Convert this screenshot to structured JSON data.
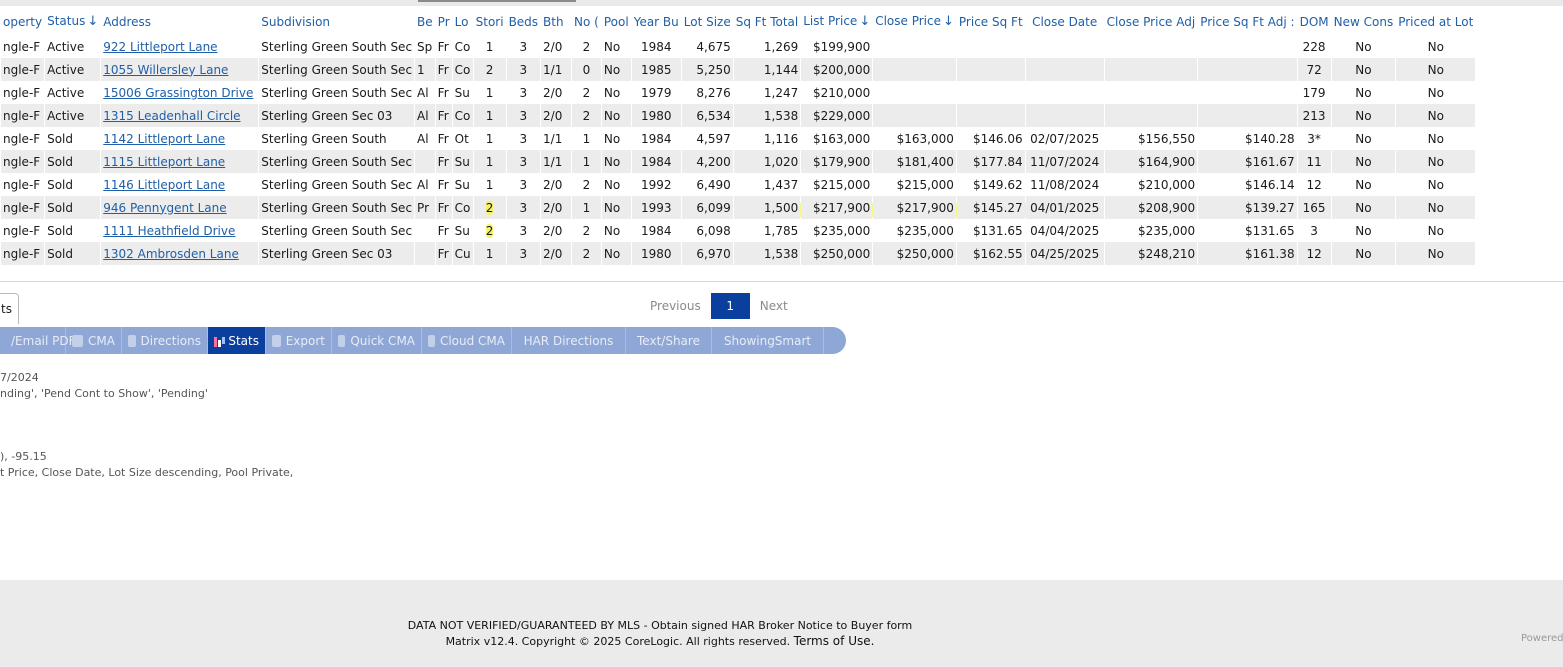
{
  "columns": [
    "operty",
    "Status",
    "Address",
    "Subdivision",
    "Be",
    "Pr",
    "Lo",
    "Stori",
    "Beds",
    "Bth",
    "No (",
    "Pool",
    "Year Bu",
    "Lot Size",
    "Sq Ft Total",
    "List Price",
    "Close Price",
    "Price Sq Ft",
    "Close Date",
    "Close Price Adj",
    "Price Sq Ft Adj :",
    "DOM",
    "New Cons",
    "Priced at Lot"
  ],
  "rows": [
    [
      "ngle-F",
      "Active",
      "922 Littleport Lane",
      "Sterling Green South Sec",
      "Sp",
      "Fr",
      "Co",
      "1",
      "3",
      "2/0",
      "2",
      "No",
      "1984",
      "4,675",
      "1,269",
      "$199,900",
      "",
      "",
      "",
      "",
      "",
      "228",
      "No",
      "No"
    ],
    [
      "ngle-F",
      "Active",
      "1055 Willersley Lane",
      "Sterling Green South Sec",
      "1",
      "Fr",
      "Co",
      "2",
      "3",
      "1/1",
      "0",
      "No",
      "1985",
      "5,250",
      "1,144",
      "$200,000",
      "",
      "",
      "",
      "",
      "",
      "72",
      "No",
      "No"
    ],
    [
      "ngle-F",
      "Active",
      "15006 Grassington Drive",
      "Sterling Green South Sec",
      "Al",
      "Fr",
      "Su",
      "1",
      "3",
      "2/0",
      "2",
      "No",
      "1979",
      "8,276",
      "1,247",
      "$210,000",
      "",
      "",
      "",
      "",
      "",
      "179",
      "No",
      "No"
    ],
    [
      "ngle-F",
      "Active",
      "1315 Leadenhall Circle",
      "Sterling Green Sec 03",
      "Al",
      "Fr",
      "Co",
      "1",
      "3",
      "2/0",
      "2",
      "No",
      "1980",
      "6,534",
      "1,538",
      "$229,000",
      "",
      "",
      "",
      "",
      "",
      "213",
      "No",
      "No"
    ],
    [
      "ngle-F",
      "Sold",
      "1142 Littleport Lane",
      "Sterling Green South",
      "Al",
      "Fr",
      "Ot",
      "1",
      "3",
      "1/1",
      "1",
      "No",
      "1984",
      "4,597",
      "1,116",
      "$163,000",
      "$163,000",
      "$146.06",
      "02/07/2025",
      "$156,550",
      "$140.28",
      "3*",
      "No",
      "No"
    ],
    [
      "ngle-F",
      "Sold",
      "1115 Littleport Lane",
      "Sterling Green South Sec",
      "",
      "Fr",
      "Su",
      "1",
      "3",
      "1/1",
      "1",
      "No",
      "1984",
      "4,200",
      "1,020",
      "$179,900",
      "$181,400",
      "$177.84",
      "11/07/2024",
      "$164,900",
      "$161.67",
      "11",
      "No",
      "No"
    ],
    [
      "ngle-F",
      "Sold",
      "1146 Littleport Lane",
      "Sterling Green South Sec",
      "Al",
      "Fr",
      "Su",
      "1",
      "3",
      "2/0",
      "2",
      "No",
      "1992",
      "6,490",
      "1,437",
      "$215,000",
      "$215,000",
      "$149.62",
      "11/08/2024",
      "$210,000",
      "$146.14",
      "12",
      "No",
      "No"
    ],
    [
      "ngle-F",
      "Sold",
      "946 Pennygent Lane",
      "Sterling Green South Sec",
      "Pr",
      "Fr",
      "Co",
      "2",
      "3",
      "2/0",
      "1",
      "No",
      "1993",
      "6,099",
      "1,500",
      "$217,900",
      "$217,900",
      "$145.27",
      "04/01/2025",
      "$208,900",
      "$139.27",
      "165",
      "No",
      "No"
    ],
    [
      "ngle-F",
      "Sold",
      "1111 Heathfield Drive",
      "Sterling Green South Sec",
      "",
      "Fr",
      "Su",
      "2",
      "3",
      "2/0",
      "2",
      "No",
      "1984",
      "6,098",
      "1,785",
      "$235,000",
      "$235,000",
      "$131.65",
      "04/04/2025",
      "$235,000",
      "$131.65",
      "3",
      "No",
      "No"
    ],
    [
      "ngle-F",
      "Sold",
      "1302 Ambrosden Lane",
      "Sterling Green Sec 03",
      "",
      "Fr",
      "Cu",
      "1",
      "3",
      "2/0",
      "2",
      "No",
      "1980",
      "6,970",
      "1,538",
      "$250,000",
      "$250,000",
      "$162.55",
      "04/25/2025",
      "$248,210",
      "$161.38",
      "12",
      "No",
      "No"
    ]
  ],
  "pager": {
    "previous": "Previous",
    "current": "1",
    "next": "Next"
  },
  "left_tab": "ts",
  "toolbar": [
    {
      "label": "/Email PDF",
      "icon": "pdf-icon"
    },
    {
      "label": "CMA",
      "icon": "document-icon"
    },
    {
      "label": "Directions",
      "icon": "compass-icon"
    },
    {
      "label": "Stats",
      "icon": "bar-chart-icon",
      "active": true
    },
    {
      "label": "Export",
      "icon": "export-icon"
    },
    {
      "label": "Quick CMA",
      "icon": "copy-icon"
    },
    {
      "label": "Cloud CMA",
      "icon": "cloud-document-icon"
    },
    {
      "label": "HAR Directions",
      "icon": ""
    },
    {
      "label": "Text/Share",
      "icon": ""
    },
    {
      "label": "ShowingSmart",
      "icon": ""
    }
  ],
  "criteria": {
    "line1": "7/2024",
    "line2": "nding', 'Pend Cont to Show', 'Pending'",
    "line3": "), -95.15",
    "line4": "t Price, Close Date, Lot Size descending, Pool Private,"
  },
  "footer": {
    "disclaimer": "DATA NOT VERIFIED/GUARANTEED BY MLS - Obtain signed HAR Broker Notice to Buyer form",
    "copyright": "Matrix v12.4. Copyright © 2025 CoreLogic. All rights reserved.",
    "terms": "Terms of Use.",
    "powered": "Powered"
  },
  "colors": {
    "link": "#1f5fa8",
    "active_tab": "#0b3f9e",
    "toolbar": "#8fa7d6",
    "highlight": "#f6f46a"
  }
}
